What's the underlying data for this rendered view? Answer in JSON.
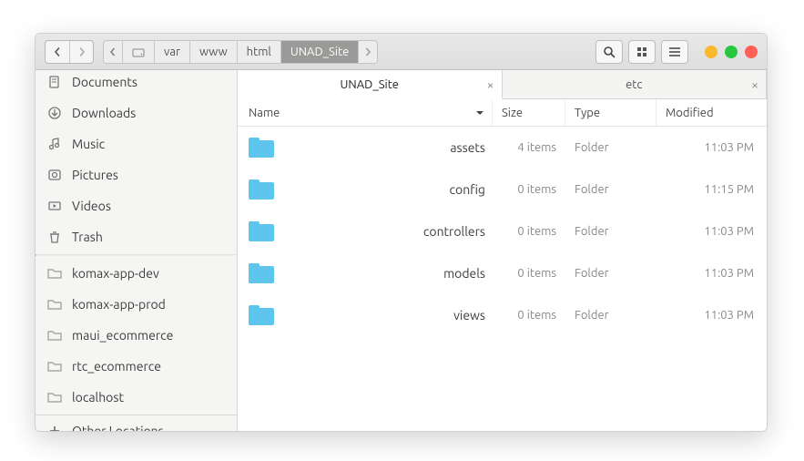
{
  "breadcrumb": [
    "var",
    "www",
    "html",
    "UNAD_Site"
  ],
  "breadcrumb_active_index": 3,
  "window_controls": {
    "min": "#f9b82d",
    "max": "#29c740",
    "close": "#ff5f56"
  },
  "sidebar": {
    "places": [
      {
        "icon": "documents",
        "label": "Documents"
      },
      {
        "icon": "downloads",
        "label": "Downloads"
      },
      {
        "icon": "music",
        "label": "Music"
      },
      {
        "icon": "pictures",
        "label": "Pictures"
      },
      {
        "icon": "videos",
        "label": "Videos"
      },
      {
        "icon": "trash",
        "label": "Trash"
      }
    ],
    "bookmarks": [
      {
        "icon": "folder",
        "label": "komax-app-dev"
      },
      {
        "icon": "folder",
        "label": "komax-app-prod"
      },
      {
        "icon": "folder",
        "label": "maui_ecommerce"
      },
      {
        "icon": "folder",
        "label": "rtc_ecommerce"
      },
      {
        "icon": "folder",
        "label": "localhost"
      }
    ],
    "other": {
      "label": "Other Locations"
    }
  },
  "tabs": [
    {
      "label": "UNAD_Site",
      "active": true
    },
    {
      "label": "etc",
      "active": false
    }
  ],
  "columns": {
    "name": "Name",
    "size": "Size",
    "type": "Type",
    "modified": "Modified"
  },
  "rows": [
    {
      "name": "assets",
      "size": "4 items",
      "type": "Folder",
      "modified": "11:03 PM"
    },
    {
      "name": "config",
      "size": "0 items",
      "type": "Folder",
      "modified": "11:15 PM"
    },
    {
      "name": "controllers",
      "size": "0 items",
      "type": "Folder",
      "modified": "11:03 PM"
    },
    {
      "name": "models",
      "size": "0 items",
      "type": "Folder",
      "modified": "11:03 PM"
    },
    {
      "name": "views",
      "size": "0 items",
      "type": "Folder",
      "modified": "11:03 PM"
    }
  ]
}
